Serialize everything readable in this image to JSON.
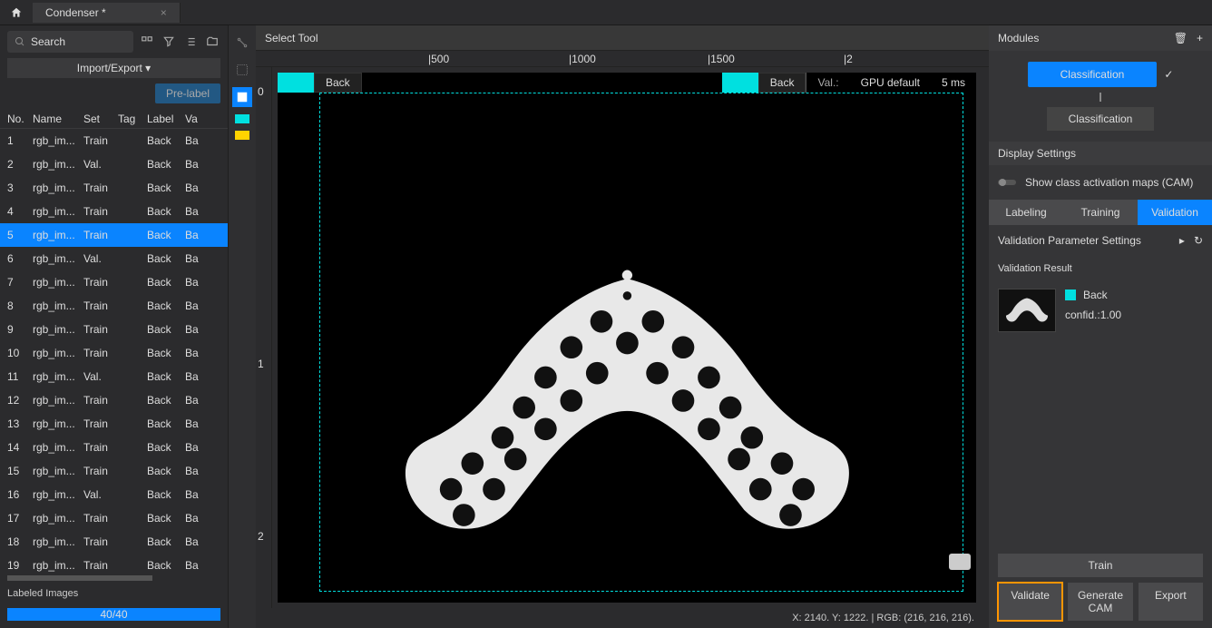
{
  "titlebar": {
    "tab": "Condenser *"
  },
  "search": {
    "placeholder": "Search"
  },
  "import_export": "Import/Export ▾",
  "prelabel": "Pre-label",
  "columns": {
    "no": "No.",
    "name": "Name",
    "set": "Set",
    "tag": "Tag",
    "label": "Label",
    "val": "Va"
  },
  "rows": [
    {
      "no": "1",
      "name": "rgb_im...",
      "set": "Train",
      "label": "Back",
      "val": "Ba"
    },
    {
      "no": "2",
      "name": "rgb_im...",
      "set": "Val.",
      "label": "Back",
      "val": "Ba"
    },
    {
      "no": "3",
      "name": "rgb_im...",
      "set": "Train",
      "label": "Back",
      "val": "Ba"
    },
    {
      "no": "4",
      "name": "rgb_im...",
      "set": "Train",
      "label": "Back",
      "val": "Ba"
    },
    {
      "no": "5",
      "name": "rgb_im...",
      "set": "Train",
      "label": "Back",
      "val": "Ba"
    },
    {
      "no": "6",
      "name": "rgb_im...",
      "set": "Val.",
      "label": "Back",
      "val": "Ba"
    },
    {
      "no": "7",
      "name": "rgb_im...",
      "set": "Train",
      "label": "Back",
      "val": "Ba"
    },
    {
      "no": "8",
      "name": "rgb_im...",
      "set": "Train",
      "label": "Back",
      "val": "Ba"
    },
    {
      "no": "9",
      "name": "rgb_im...",
      "set": "Train",
      "label": "Back",
      "val": "Ba"
    },
    {
      "no": "10",
      "name": "rgb_im...",
      "set": "Train",
      "label": "Back",
      "val": "Ba"
    },
    {
      "no": "11",
      "name": "rgb_im...",
      "set": "Val.",
      "label": "Back",
      "val": "Ba"
    },
    {
      "no": "12",
      "name": "rgb_im...",
      "set": "Train",
      "label": "Back",
      "val": "Ba"
    },
    {
      "no": "13",
      "name": "rgb_im...",
      "set": "Train",
      "label": "Back",
      "val": "Ba"
    },
    {
      "no": "14",
      "name": "rgb_im...",
      "set": "Train",
      "label": "Back",
      "val": "Ba"
    },
    {
      "no": "15",
      "name": "rgb_im...",
      "set": "Train",
      "label": "Back",
      "val": "Ba"
    },
    {
      "no": "16",
      "name": "rgb_im...",
      "set": "Val.",
      "label": "Back",
      "val": "Ba"
    },
    {
      "no": "17",
      "name": "rgb_im...",
      "set": "Train",
      "label": "Back",
      "val": "Ba"
    },
    {
      "no": "18",
      "name": "rgb_im...",
      "set": "Train",
      "label": "Back",
      "val": "Ba"
    },
    {
      "no": "19",
      "name": "rgb_im...",
      "set": "Train",
      "label": "Back",
      "val": "Ba"
    }
  ],
  "selected_row": 4,
  "labeled_images": "Labeled Images",
  "progress": "40/40",
  "canvas": {
    "select_tool": "Select Tool",
    "ruler_h": [
      "|500",
      "|1000",
      "|1500",
      "|2"
    ],
    "ruler_v": [
      "0",
      "1",
      "2"
    ],
    "overlay_label": "Back",
    "overlay_label2": "Back",
    "val_label": "Val.:",
    "gpu": "GPU default",
    "time": "5 ms",
    "status": "X: 2140. Y: 1222. | RGB: (216, 216, 216)."
  },
  "right": {
    "modules_title": "Modules",
    "node1": "Classification",
    "node2": "Classification",
    "display_settings": "Display Settings",
    "cam_label": "Show class activation maps (CAM)",
    "tabs": {
      "labeling": "Labeling",
      "training": "Training",
      "validation": "Validation"
    },
    "param_label": "Validation Parameter Settings",
    "result_label": "Validation Result",
    "res_class": "Back",
    "res_conf": "confid.:1.00",
    "train": "Train",
    "validate": "Validate",
    "generate_cam": "Generate CAM",
    "export": "Export"
  }
}
